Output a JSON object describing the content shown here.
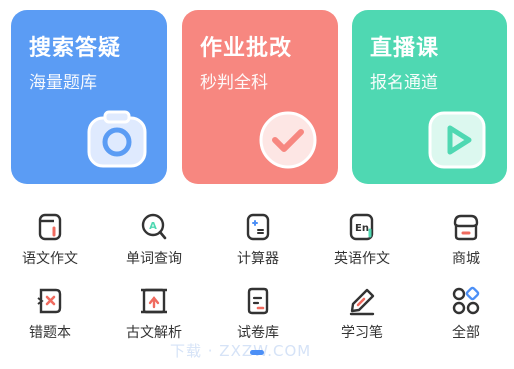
{
  "feature_cards": [
    {
      "title": "搜索答疑",
      "subtitle": "海量题库",
      "icon": "camera-icon",
      "color": "#5b9cf4"
    },
    {
      "title": "作业批改",
      "subtitle": "秒判全科",
      "icon": "check-circle-icon",
      "color": "#f78780"
    },
    {
      "title": "直播课",
      "subtitle": "报名通道",
      "icon": "play-icon",
      "color": "#4fd8b2"
    }
  ],
  "tools": [
    {
      "label": "语文作文",
      "icon": "essay-book-icon"
    },
    {
      "label": "单词查询",
      "icon": "word-search-icon"
    },
    {
      "label": "计算器",
      "icon": "calculator-icon"
    },
    {
      "label": "英语作文",
      "icon": "english-essay-icon"
    },
    {
      "label": "商城",
      "icon": "shop-icon"
    },
    {
      "label": "错题本",
      "icon": "wrong-book-icon"
    },
    {
      "label": "古文解析",
      "icon": "classical-text-icon"
    },
    {
      "label": "试卷库",
      "icon": "exam-paper-icon"
    },
    {
      "label": "学习笔",
      "icon": "study-pen-icon"
    },
    {
      "label": "全部",
      "icon": "all-grid-icon"
    }
  ],
  "pager": {
    "active_index": 0
  },
  "watermark": "下载 · ZXZW.COM",
  "colors": {
    "accent": "#4c8ff6",
    "icon_stroke": "#333333"
  }
}
